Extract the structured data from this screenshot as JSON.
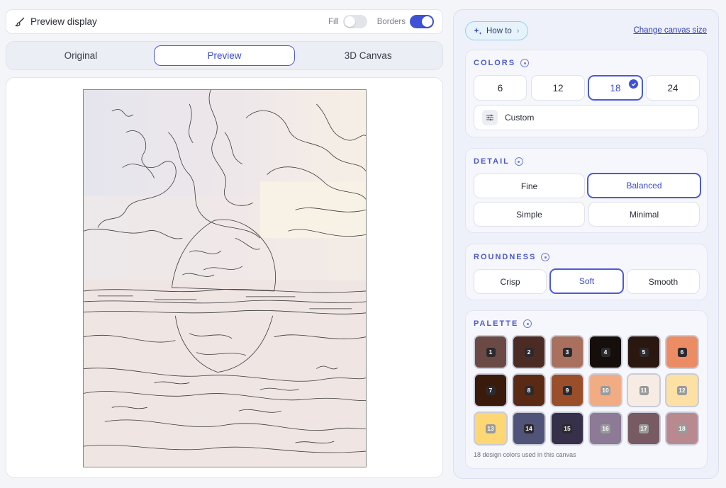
{
  "topbar": {
    "title": "Preview display",
    "fill_label": "Fill",
    "fill_on": false,
    "borders_label": "Borders",
    "borders_on": true
  },
  "tabs": [
    {
      "label": "Original",
      "active": false
    },
    {
      "label": "Preview",
      "active": true
    },
    {
      "label": "3D Canvas",
      "active": false
    }
  ],
  "panel": {
    "howto_label": "How to",
    "change_canvas_label": "Change canvas size",
    "colors": {
      "title": "COLORS",
      "options": [
        "6",
        "12",
        "18",
        "24"
      ],
      "selected": "18",
      "custom_label": "Custom"
    },
    "detail": {
      "title": "DETAIL",
      "options": [
        "Fine",
        "Balanced",
        "Simple",
        "Minimal"
      ],
      "selected": "Balanced"
    },
    "roundness": {
      "title": "ROUNDNESS",
      "options": [
        "Crisp",
        "Soft",
        "Smooth"
      ],
      "selected": "Soft"
    },
    "palette": {
      "title": "PALETTE",
      "swatches": [
        {
          "n": "1",
          "color": "#6b4a45"
        },
        {
          "n": "2",
          "color": "#4b2b24"
        },
        {
          "n": "3",
          "color": "#a8705d"
        },
        {
          "n": "4",
          "color": "#150e0b"
        },
        {
          "n": "5",
          "color": "#2a170f"
        },
        {
          "n": "6",
          "color": "#ec8c64"
        },
        {
          "n": "7",
          "color": "#3a1a0a"
        },
        {
          "n": "8",
          "color": "#5a2a14"
        },
        {
          "n": "9",
          "color": "#9a4e2a"
        },
        {
          "n": "10",
          "color": "#f2ac84"
        },
        {
          "n": "11",
          "color": "#f6ece4"
        },
        {
          "n": "12",
          "color": "#fde0a4"
        },
        {
          "n": "13",
          "color": "#fcd773"
        },
        {
          "n": "14",
          "color": "#515479"
        },
        {
          "n": "15",
          "color": "#36304a"
        },
        {
          "n": "16",
          "color": "#8c7a96"
        },
        {
          "n": "17",
          "color": "#785a62"
        },
        {
          "n": "18",
          "color": "#b88a90"
        }
      ],
      "note": "18 design colors used in this canvas"
    }
  },
  "colors": {
    "accent": "#3f51d6",
    "sky_left": "#e8e8f0",
    "canvas_warm": "#f3e8e2"
  }
}
